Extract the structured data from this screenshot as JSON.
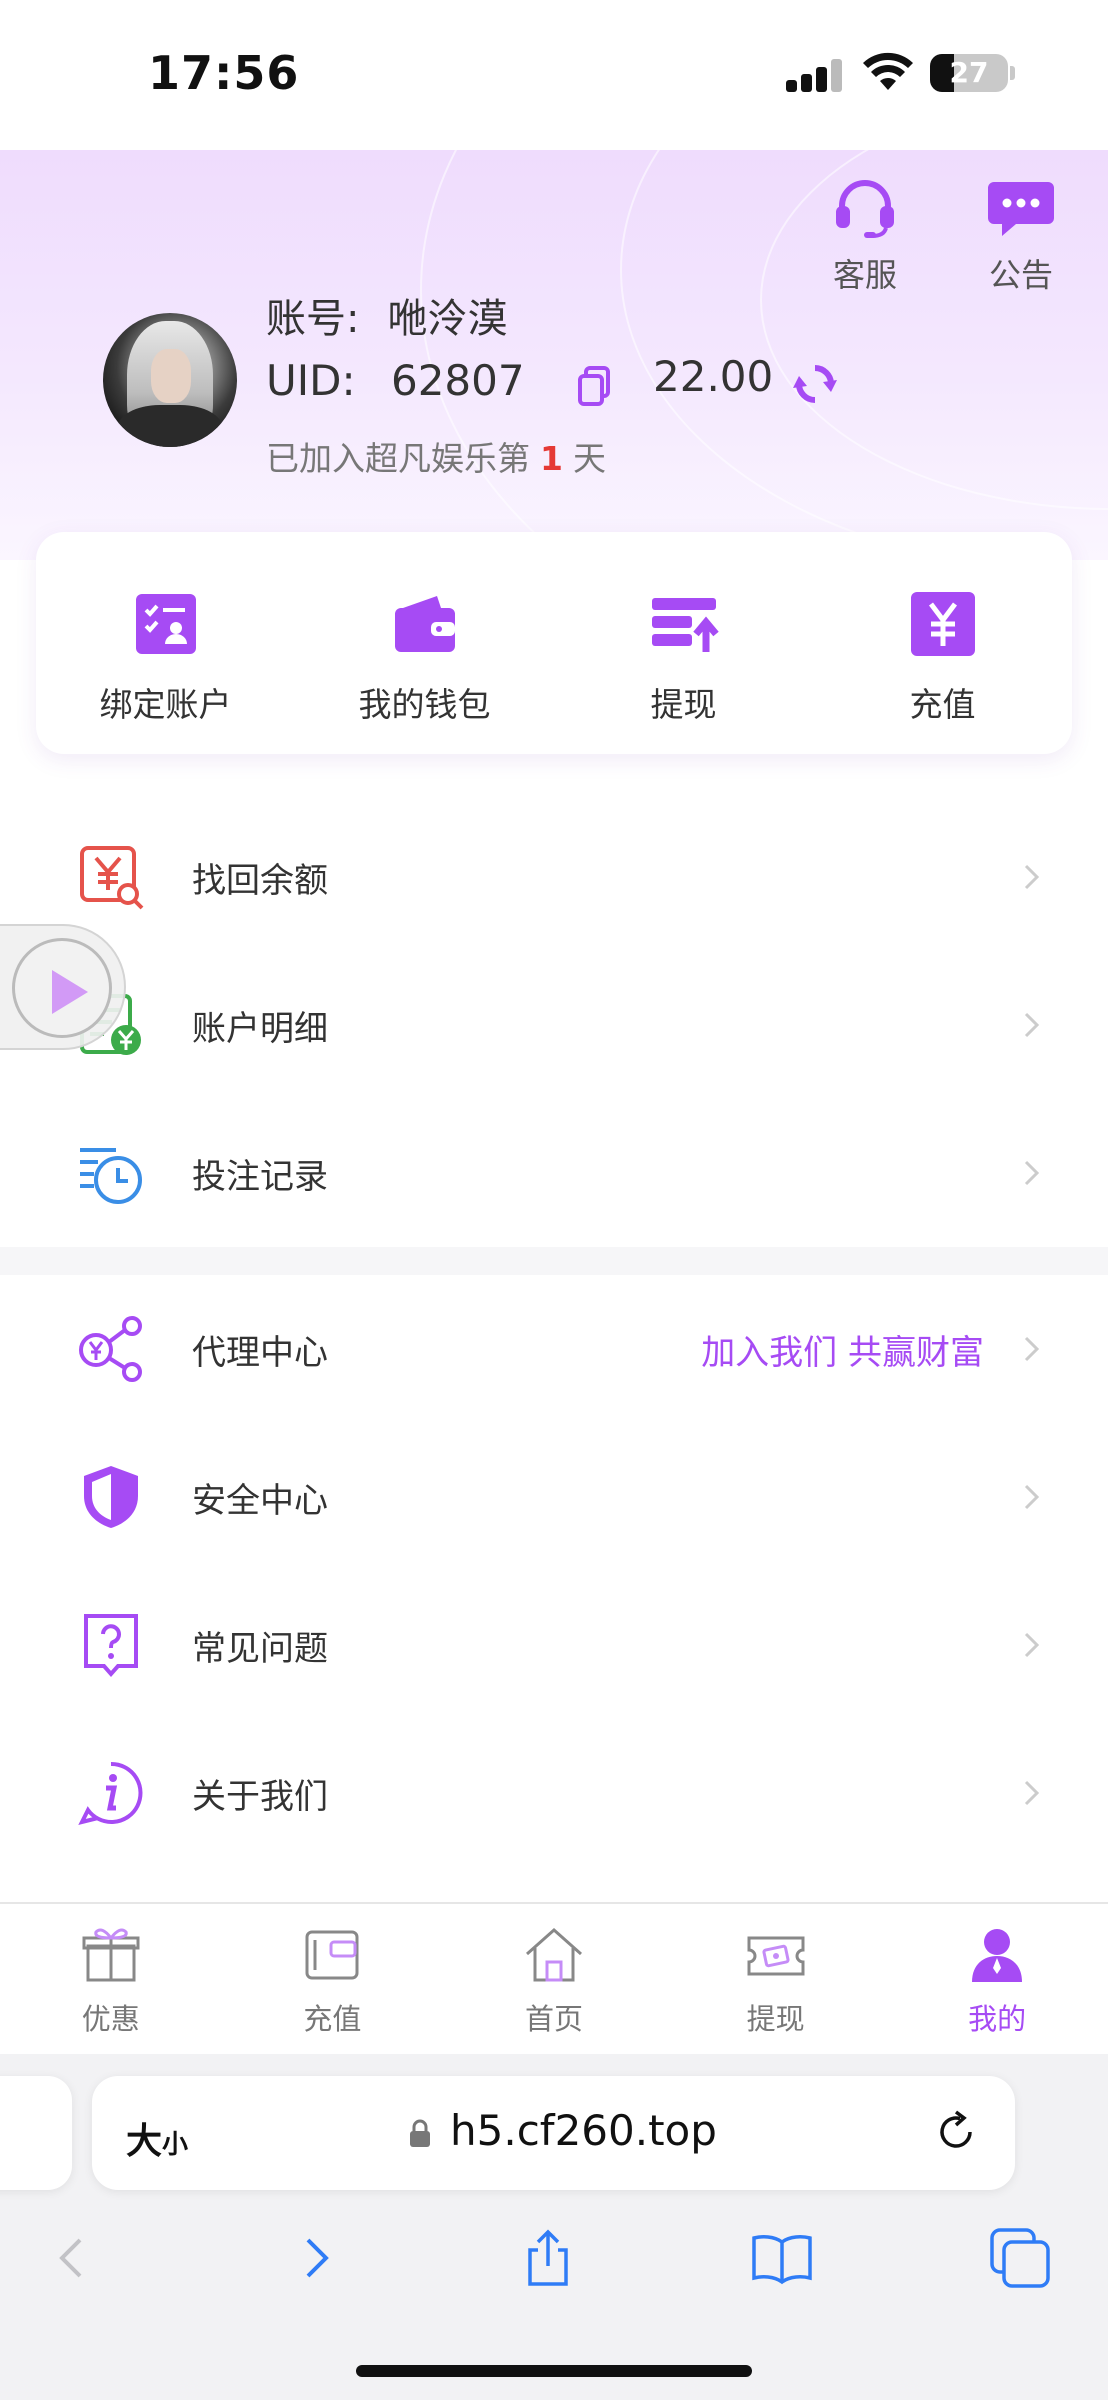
{
  "status_bar": {
    "time": "17:56",
    "battery": "27"
  },
  "header": {
    "support_label": "客服",
    "notice_label": "公告",
    "account_key": "账号:",
    "account_value": "咃泠漠",
    "uid_key": "UID:",
    "uid_value": "62807",
    "balance": "22.00",
    "join_prefix": "已加入超凡娱乐第",
    "join_days": "1",
    "join_suffix": "天"
  },
  "quick_actions": [
    {
      "label": "绑定账户",
      "icon": "bind-account-icon"
    },
    {
      "label": "我的钱包",
      "icon": "wallet-icon"
    },
    {
      "label": "提现",
      "icon": "withdraw-icon"
    },
    {
      "label": "充值",
      "icon": "recharge-icon"
    }
  ],
  "menu_primary": [
    {
      "label": "找回余额",
      "icon": "recover-balance-icon"
    },
    {
      "label": "账户明细",
      "icon": "account-details-icon"
    },
    {
      "label": "投注记录",
      "icon": "bet-records-icon"
    }
  ],
  "menu_secondary": [
    {
      "label": "代理中心",
      "extra": "加入我们 共赢财富",
      "icon": "agent-center-icon"
    },
    {
      "label": "安全中心",
      "icon": "security-center-icon"
    },
    {
      "label": "常见问题",
      "icon": "faq-icon"
    },
    {
      "label": "关于我们",
      "icon": "about-us-icon"
    }
  ],
  "tabbar": [
    {
      "label": "优惠",
      "icon": "gift-icon",
      "active": false
    },
    {
      "label": "充值",
      "icon": "card-icon",
      "active": false
    },
    {
      "label": "首页",
      "icon": "home-icon",
      "active": false
    },
    {
      "label": "提现",
      "icon": "cash-icon",
      "active": false
    },
    {
      "label": "我的",
      "icon": "profile-icon",
      "active": true
    }
  ],
  "browser": {
    "text_size_label": "大",
    "text_size_small": "小",
    "url": "h5.cf260.top"
  },
  "colors": {
    "accent": "#a64bf4",
    "highlight_red": "#e53935"
  }
}
